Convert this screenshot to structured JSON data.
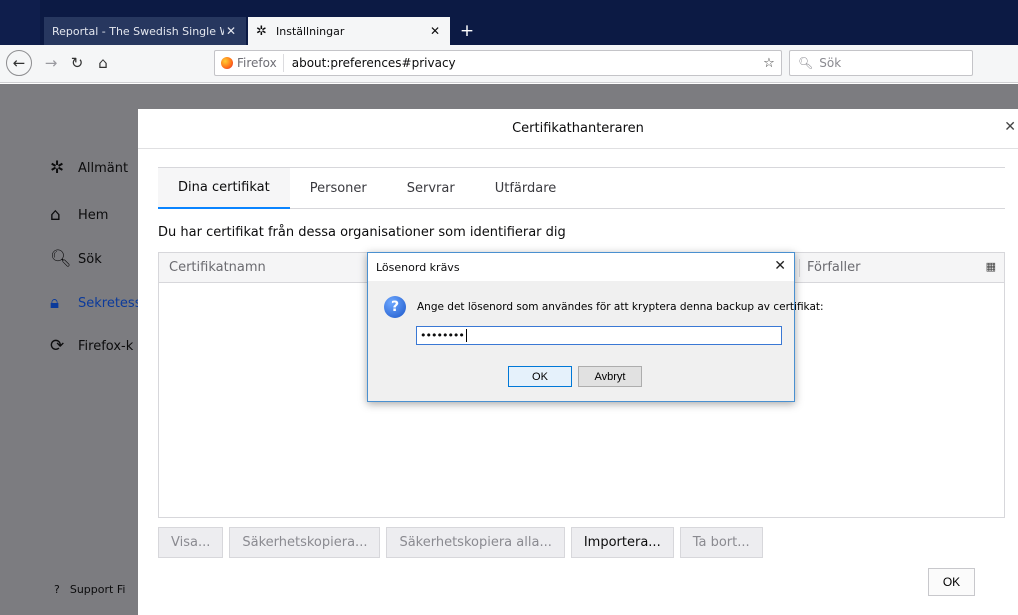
{
  "tabs": [
    {
      "title": "Reportal - The Swedish Single Wind",
      "close": "✕"
    },
    {
      "title": "Inställningar",
      "close": "✕"
    }
  ],
  "newtab_label": "+",
  "urlbar": {
    "identity": "Firefox",
    "url": "about:preferences#privacy"
  },
  "searchbar": {
    "placeholder": "Sök"
  },
  "sidebar": {
    "items": [
      {
        "label": "Allmänt",
        "icon": "gear-icon"
      },
      {
        "label": "Hem",
        "icon": "home-icon"
      },
      {
        "label": "Sök",
        "icon": "search-icon"
      },
      {
        "label": "Sekretess",
        "icon": "lock-icon",
        "selected": true
      },
      {
        "label": "Firefox-k",
        "icon": "sync-icon"
      }
    ],
    "support": "Support Fi"
  },
  "cert_manager": {
    "title": "Certifikathanteraren",
    "tabs": [
      "Dina certifikat",
      "Personer",
      "Servrar",
      "Utfärdare"
    ],
    "active_tab": 0,
    "description": "Du har certifikat från dessa organisationer som identifierar dig",
    "columns": [
      "Certifikatnamn",
      "Förfaller"
    ],
    "buttons": [
      {
        "label": "Visa...",
        "enabled": false
      },
      {
        "label": "Säkerhetskopiera...",
        "enabled": false
      },
      {
        "label": "Säkerhetskopiera alla...",
        "enabled": false
      },
      {
        "label": "Importera...",
        "enabled": true
      },
      {
        "label": "Ta bort...",
        "enabled": false
      }
    ],
    "ok_label": "OK"
  },
  "password_dialog": {
    "title": "Lösenord krävs",
    "message": "Ange det lösenord som användes för att kryptera denna backup av certifikat:",
    "masked_value": "••••••••",
    "ok_label": "OK",
    "cancel_label": "Avbryt"
  }
}
